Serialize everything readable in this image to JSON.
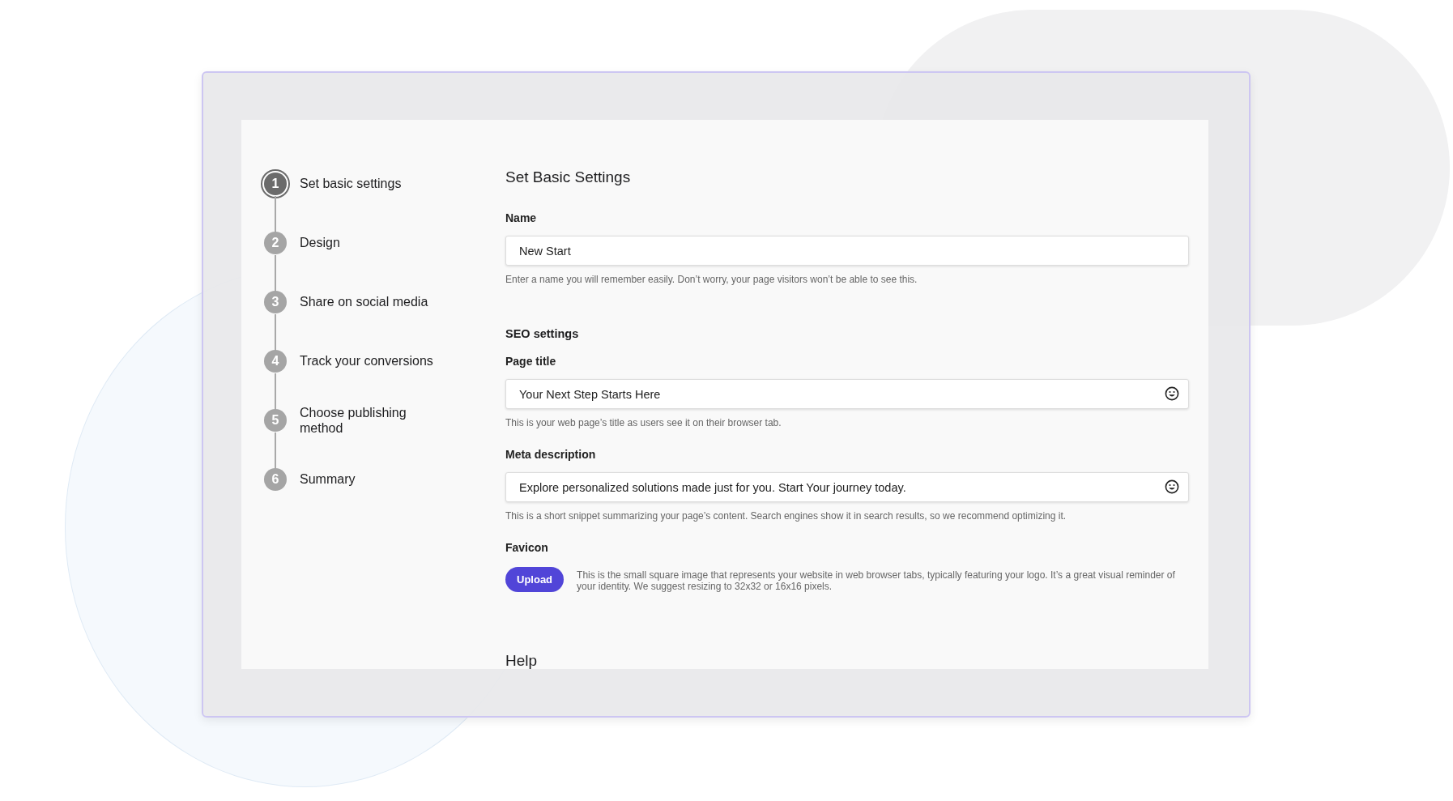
{
  "steps": [
    {
      "number": "1",
      "label": "Set basic settings",
      "selected": true
    },
    {
      "number": "2",
      "label": "Design",
      "selected": false
    },
    {
      "number": "3",
      "label": "Share on social media",
      "selected": false
    },
    {
      "number": "4",
      "label": "Track your conversions",
      "selected": false
    },
    {
      "number": "5",
      "label": "Choose publishing method",
      "selected": false
    },
    {
      "number": "6",
      "label": "Summary",
      "selected": false
    }
  ],
  "form": {
    "title": "Set Basic Settings",
    "name_field": {
      "label": "Name",
      "value": "New Start",
      "emoji_button": false,
      "help": "Enter a name you will remember easily. Don’t worry, your page visitors won’t be able to see this."
    },
    "seo_heading": "SEO settings",
    "seo_fields": [
      {
        "label": "Page title",
        "value": "Your Next Step Starts Here",
        "emoji_button": true,
        "help": "This is your web page’s title as users see it on their browser tab."
      },
      {
        "label": "Meta description",
        "value": "Explore personalized solutions made just for you. Start Your journey today.",
        "emoji_button": true,
        "help": "This is a short snippet summarizing your page’s content. Search engines show it in search results, so we recommend optimizing it."
      }
    ],
    "favicon": {
      "label": "Favicon",
      "button": "Upload",
      "help": "This is the small square image that represents your website in web browser tabs, typically featuring your logo. It’s a great visual reminder of your identity. We suggest resizing to 32x32 or 16x16 pixels."
    },
    "next_heading": "Help"
  }
}
